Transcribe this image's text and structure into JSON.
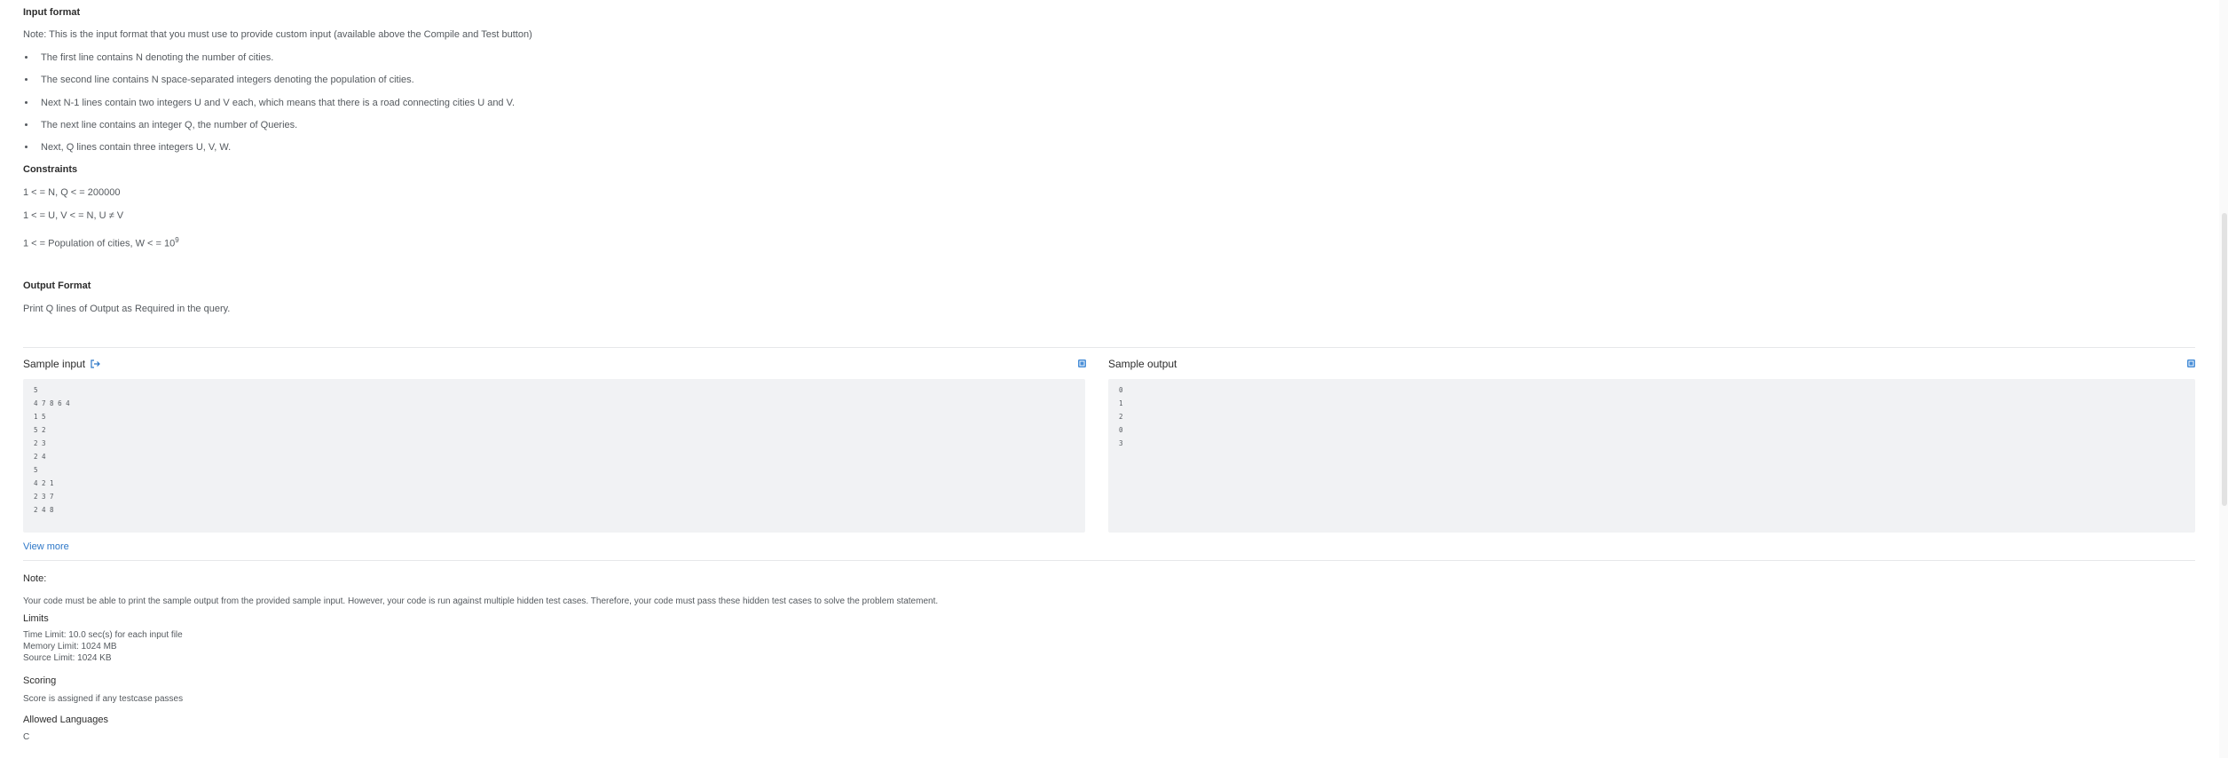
{
  "input_format": {
    "title": "Input format",
    "note": "Note: This is the input format that you must use to provide custom input (available above the Compile and Test button)",
    "bullets": [
      "The first line contains N denoting the number of cities.",
      "The second line contains N space-separated integers denoting the population of cities.",
      "Next N-1 lines contain two integers U and V each, which means that there is a road connecting cities U and V.",
      "The next line contains an integer Q, the number of Queries.",
      "Next, Q lines contain three integers U, V, W."
    ]
  },
  "constraints": {
    "title": "Constraints",
    "lines": [
      "1 < = N, Q < = 200000",
      "1 < = U, V < = N, U ≠ V"
    ],
    "population_prefix": "1 < = Population of cities, W < = 10",
    "population_exp": "9"
  },
  "output_format": {
    "title": "Output Format",
    "text": "Print Q lines of Output as Required in the query."
  },
  "sample_input": {
    "title": "Sample input",
    "lines": [
      "5",
      "4 7 8 6 4",
      "1 5",
      "5 2",
      "2 3",
      "2 4",
      "5",
      "4 2 1",
      "2 3 7",
      "2 4 8"
    ]
  },
  "sample_output": {
    "title": "Sample output",
    "lines": [
      "0",
      "1",
      "2",
      "0",
      "3"
    ]
  },
  "view_more": "View more",
  "note": {
    "title": "Note:",
    "text": "Your code must be able to print the sample output from the provided sample input. However, your code is run against multiple hidden test cases. Therefore, your code must pass these hidden test cases to solve the problem statement."
  },
  "limits": {
    "title": "Limits",
    "lines": [
      "Time Limit: 10.0 sec(s) for each input file",
      "Memory Limit: 1024 MB",
      "Source Limit: 1024 KB"
    ]
  },
  "scoring": {
    "title": "Scoring",
    "text": "Score is assigned if any testcase passes"
  },
  "allowed_languages": {
    "title": "Allowed Languages",
    "text": "C"
  },
  "colors": {
    "accent": "#2d77c8",
    "code_bg": "#f1f2f4",
    "text": "#555a5f"
  }
}
